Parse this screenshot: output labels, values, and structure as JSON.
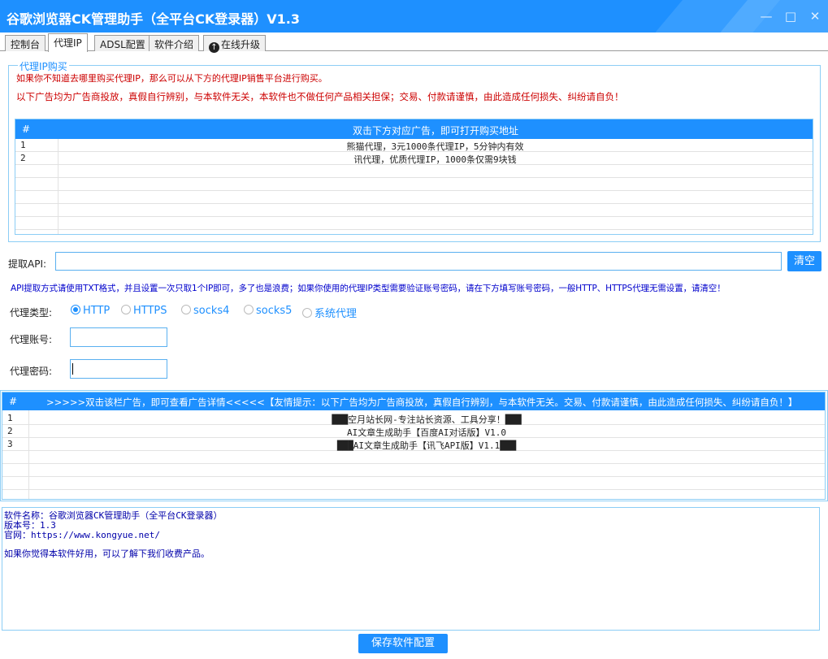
{
  "window": {
    "title": "谷歌浏览器CK管理助手（全平台CK登录器）V1.3",
    "controls": [
      "minimize",
      "maximize",
      "close"
    ]
  },
  "tabs": [
    {
      "label": "控制台",
      "active": false
    },
    {
      "label": "代理IP",
      "active": true
    },
    {
      "label": "ADSL配置",
      "active": false
    },
    {
      "label": "软件介绍",
      "active": false
    },
    {
      "label": "在线升级",
      "active": false,
      "icon": "upload-circle-icon"
    }
  ],
  "proxy_purchase": {
    "legend": "代理IP购买",
    "notice1": "如果你不知道去哪里购买代理IP，那么可以从下方的代理IP销售平台进行购买。",
    "notice2": "以下广告均为广告商投放，真假自行辨别，与本软件无关，本软件也不做任何产品相关担保；交易、付款请谨慎，由此造成任何损失、纠纷请自负！",
    "grid": {
      "col_num": "#",
      "col_title": "双击下方对应广告，即可打开购买地址",
      "rows": [
        {
          "num": "1",
          "text": "熊猫代理，3元1000条代理IP，5分钟内有效"
        },
        {
          "num": "2",
          "text": "讯代理，优质代理IP，1000条仅需9块钱"
        }
      ]
    }
  },
  "api": {
    "label": "提取API:",
    "value": "",
    "clear_label": "清空",
    "tip": "API提取方式请使用TXT格式，并且设置一次只取1个IP即可，多了也是浪费；如果你使用的代理IP类型需要验证账号密码，请在下方填写账号密码，一般HTTP、HTTPS代理无需设置，请清空！"
  },
  "proxy_type": {
    "label": "代理类型:",
    "options": [
      "HTTP",
      "HTTPS",
      "socks4",
      "socks5",
      "系统代理"
    ],
    "selected": "HTTP"
  },
  "account": {
    "label": "代理账号:",
    "value": ""
  },
  "password": {
    "label": "代理密码:",
    "value": ""
  },
  "ads": {
    "col_num": "#",
    "col_title": ">>>>>双击该栏广告，即可查看广告详情<<<<<【友情提示：以下广告均为广告商投放，真假自行辨别，与本软件无关。交易、付款请谨慎，由此造成任何损失、纠纷请自负！】",
    "rows": [
      {
        "num": "1",
        "text": "███空月站长网-专注站长资源、工具分享！███"
      },
      {
        "num": "2",
        "text": "AI文章生成助手【百度AI对话版】V1.0"
      },
      {
        "num": "3",
        "text": "███AI文章生成助手【讯飞API版】V1.1███"
      }
    ]
  },
  "info": {
    "line1": "软件名称：谷歌浏览器CK管理助手（全平台CK登录器）",
    "line2": "版本号：1.3",
    "line3": "官网：https://www.kongyue.net/",
    "line4": "如果你觉得本软件好用，可以了解下我们收费产品。"
  },
  "save_label": "保存软件配置",
  "colors": {
    "accent": "#1e90ff",
    "warning": "#cc0000",
    "info_text": "#0000aa"
  }
}
